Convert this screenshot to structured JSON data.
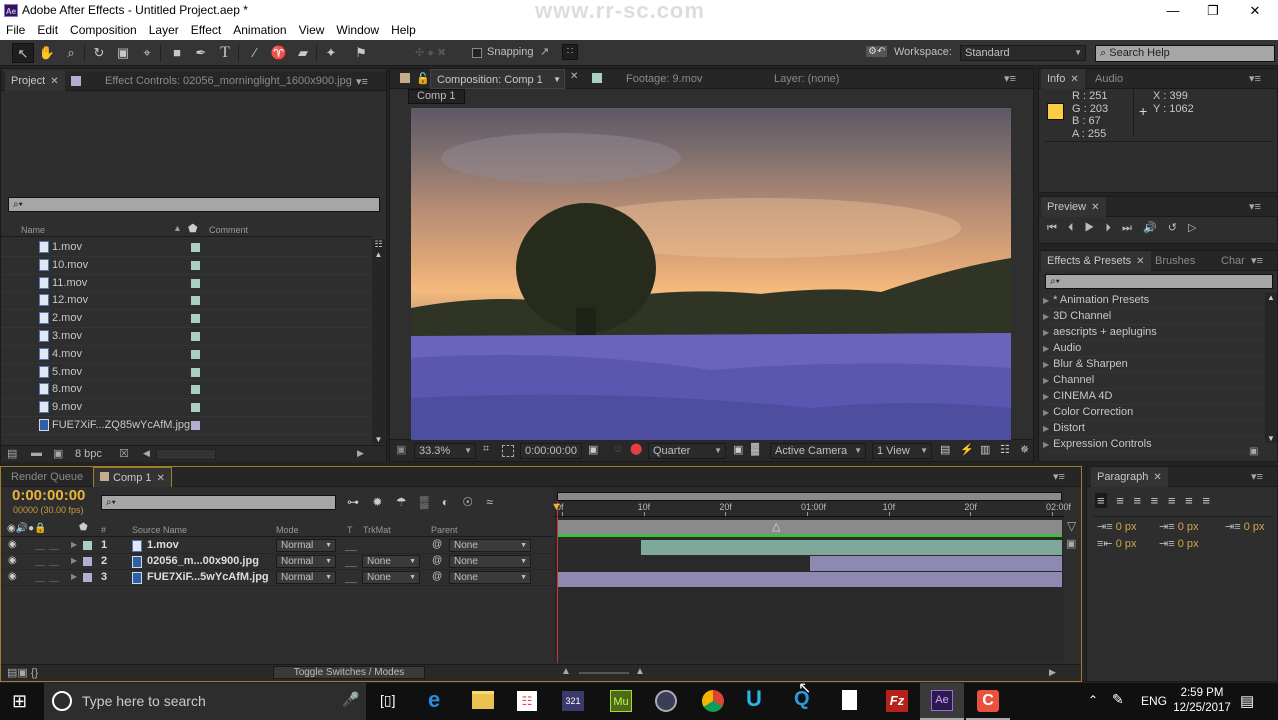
{
  "window": {
    "app_icon": "Ae",
    "title": "Adobe After Effects - Untitled Project.aep *",
    "minimize_icon": "minimize-icon",
    "restore_icon": "restore-icon",
    "close_icon": "close-icon"
  },
  "watermark": "www.rr-sc.com",
  "menu": [
    "File",
    "Edit",
    "Composition",
    "Layer",
    "Effect",
    "Animation",
    "View",
    "Window",
    "Help"
  ],
  "toolbar": {
    "tools": [
      "selection",
      "hand",
      "zoom",
      "rotation",
      "camera",
      "pan-behind",
      "rectangle",
      "pen",
      "type",
      "brush",
      "clone-stamp",
      "eraser",
      "roto-brush",
      "puppet-pin"
    ],
    "snapping_label": "Snapping",
    "workspace_label": "Workspace:",
    "workspace_value": "Standard",
    "search_help_placeholder": "Search Help"
  },
  "project_panel": {
    "tabs": [
      {
        "label": "Project",
        "active": true
      },
      {
        "label": "Effect Controls: 02056_morninglight_1600x900.jpg",
        "active": false
      }
    ],
    "search_placeholder": "",
    "columns": {
      "name": "Name",
      "comment": "Comment"
    },
    "items": [
      {
        "name": "1.mov",
        "type": "video",
        "label_color": "#a9cfc2"
      },
      {
        "name": "10.mov",
        "type": "video",
        "label_color": "#a9cfc2"
      },
      {
        "name": "11.mov",
        "type": "video",
        "label_color": "#a9cfc2"
      },
      {
        "name": "12.mov",
        "type": "video",
        "label_color": "#a9cfc2"
      },
      {
        "name": "2.mov",
        "type": "video",
        "label_color": "#a9cfc2"
      },
      {
        "name": "3.mov",
        "type": "video",
        "label_color": "#a9cfc2"
      },
      {
        "name": "4.mov",
        "type": "video",
        "label_color": "#a9cfc2"
      },
      {
        "name": "5.mov",
        "type": "video",
        "label_color": "#a9cfc2"
      },
      {
        "name": "8.mov",
        "type": "video",
        "label_color": "#a9cfc2"
      },
      {
        "name": "9.mov",
        "type": "video",
        "label_color": "#a9cfc2"
      },
      {
        "name": "FUE7XiF...ZQ85wYcAfM.jpg",
        "type": "image",
        "label_color": "#b3aed3"
      }
    ],
    "bit_depth": "8 bpc"
  },
  "composition_panel": {
    "tabs": [
      {
        "label": "Composition: Comp 1",
        "active": true
      },
      {
        "label": "Footage: 9.mov",
        "active": false
      },
      {
        "label": "Layer: (none)",
        "active": false
      }
    ],
    "breadcrumb": "Comp 1",
    "zoom": "33.3%",
    "timecode": "0:00:00:00",
    "resolution": "Quarter",
    "camera": "Active Camera",
    "views": "1 View"
  },
  "info_panel": {
    "tabs": [
      "Info",
      "Audio"
    ],
    "color_swatch": "#fbcb43",
    "r": "R : 251",
    "g": "G : 203",
    "b": "B : 67",
    "a": "A : 255",
    "x": "X : 399",
    "y": "Y : 1062"
  },
  "preview_panel": {
    "tab": "Preview",
    "controls": [
      "first-frame",
      "previous-frame",
      "play",
      "next-frame",
      "last-frame",
      "audio",
      "loop",
      "ram-preview"
    ]
  },
  "effects_panel": {
    "tabs": [
      "Effects & Presets",
      "Brushes",
      "Char"
    ],
    "items": [
      "* Animation Presets",
      "3D Channel",
      "aescripts + aeplugins",
      "Audio",
      "Blur & Sharpen",
      "Channel",
      "CINEMA 4D",
      "Color Correction",
      "Distort",
      "Expression Controls"
    ]
  },
  "timeline": {
    "tabs": [
      {
        "label": "Render Queue",
        "active": false
      },
      {
        "label": "Comp 1",
        "active": true
      }
    ],
    "timecode": "0:00:00:00",
    "frame_info": "00000 (30.00 fps)",
    "columns": {
      "hash": "#",
      "source": "Source Name",
      "mode": "Mode",
      "t": "T",
      "trkmat": "TrkMat",
      "parent": "Parent"
    },
    "ruler": [
      "0f",
      "10f",
      "20f",
      "01:00f",
      "10f",
      "20f",
      "02:00f"
    ],
    "layers": [
      {
        "num": "1",
        "name": "1.mov",
        "type": "video",
        "label_color": "#a9cfc2",
        "mode": "Normal",
        "trkmat": "",
        "parent": "None",
        "bar_start": 0.167,
        "bar_end": 1.0,
        "bar_color": "#7fa89b"
      },
      {
        "num": "2",
        "name": "02056_m...00x900.jpg",
        "type": "image",
        "label_color": "#b3aed3",
        "mode": "Normal",
        "trkmat": "None",
        "parent": "None",
        "bar_start": 0.5,
        "bar_end": 1.0,
        "bar_color": "#8d89b0"
      },
      {
        "num": "3",
        "name": "FUE7XiF...5wYcAfM.jpg",
        "type": "image",
        "label_color": "#b3aed3",
        "mode": "Normal",
        "trkmat": "None",
        "parent": "None",
        "bar_start": 0.0,
        "bar_end": 1.0,
        "bar_color": "#8d89b0"
      }
    ],
    "toggle_label": "Toggle Switches / Modes"
  },
  "paragraph_panel": {
    "tab": "Paragraph",
    "indent_left": "0 px",
    "indent_right": "0 px",
    "indent_first": "0 px",
    "space_before": "0 px",
    "space_after": "0 px"
  },
  "taskbar": {
    "search_placeholder": "Type here to search",
    "apps": [
      "task-view",
      "edge",
      "file-explorer",
      "store",
      "media-encoder-321",
      "muse",
      "cinema4d",
      "chrome",
      "ultraedit",
      "quicktime",
      "notepad",
      "filezilla",
      "after-effects",
      "camtasia"
    ],
    "language": "ENG",
    "time": "2:59 PM",
    "date": "12/25/2017"
  }
}
